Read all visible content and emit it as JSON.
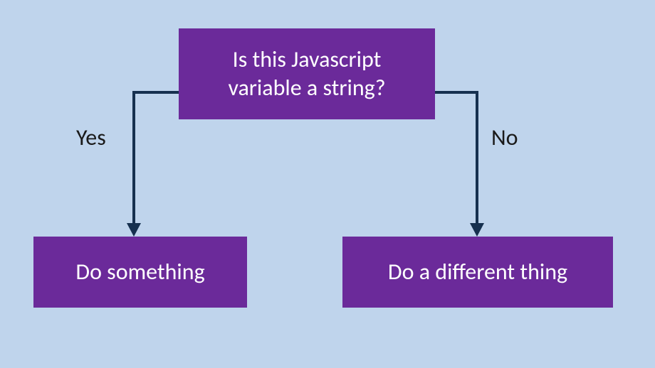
{
  "decision": {
    "question": "Is this Javascript\nvariable a string?",
    "yes_label": "Yes",
    "no_label": "No"
  },
  "outcomes": {
    "yes_action": "Do something",
    "no_action": "Do a different thing"
  },
  "colors": {
    "box_bg": "#6b2a9a",
    "box_text": "#ffffff",
    "page_bg": "#bfd4ec",
    "arrow": "#16304f",
    "label": "#1a1a1a"
  }
}
